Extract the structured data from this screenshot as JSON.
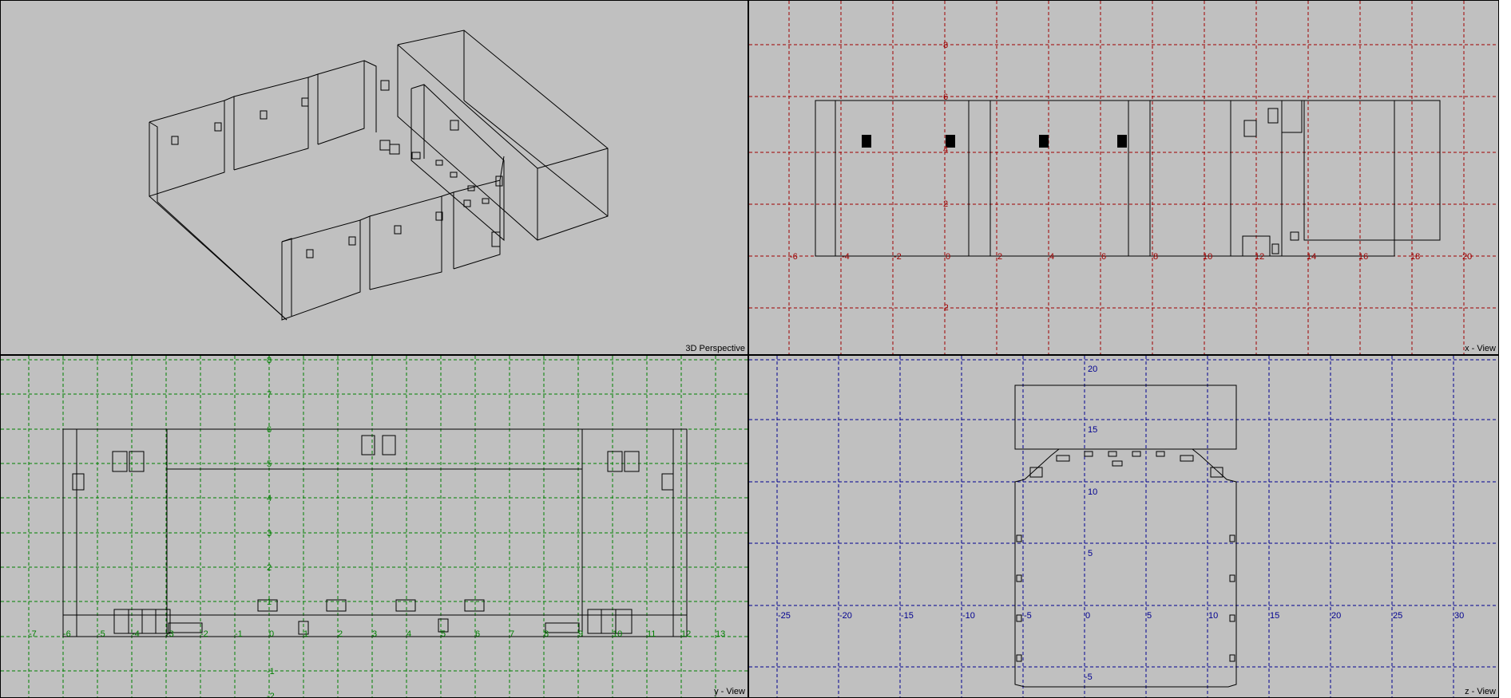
{
  "viewports": {
    "perspective": {
      "label": "3D Perspective"
    },
    "x_view": {
      "label": "x - View",
      "grid_color": "#a00000",
      "tick_labels": [
        "8",
        "6",
        "4",
        "2",
        "-2"
      ],
      "axis_labels": [
        "-6",
        "-4",
        "-2",
        "0",
        "2",
        "4",
        "6",
        "8",
        "10",
        "12",
        "14",
        "16",
        "18",
        "20"
      ]
    },
    "y_view": {
      "label": "y - View",
      "grid_color": "#008000",
      "tick_labels": [
        "8",
        "7",
        "6",
        "5",
        "4",
        "3",
        "2",
        "1",
        "-1",
        "-2"
      ],
      "axis_labels": [
        "-7",
        "-6",
        "-5",
        "-4",
        "-3",
        "-2",
        "-1",
        "0",
        "1",
        "2",
        "3",
        "4",
        "5",
        "6",
        "7",
        "8",
        "9",
        "10",
        "11",
        "12",
        "13"
      ]
    },
    "z_view": {
      "label": "z - View",
      "grid_color": "#000090",
      "tick_labels": [
        "20",
        "15",
        "10",
        "5",
        "-5"
      ],
      "axis_labels": [
        "-25",
        "-20",
        "-15",
        "-10",
        "-5",
        "0",
        "5",
        "10",
        "15",
        "20",
        "25",
        "30"
      ]
    }
  },
  "colors": {
    "viewport_bg": "#c0c0c0",
    "wire": "#000000"
  }
}
